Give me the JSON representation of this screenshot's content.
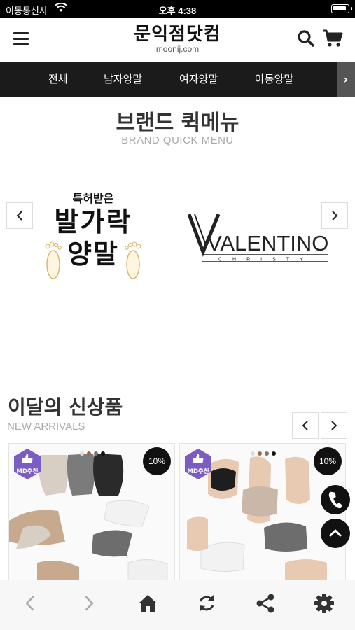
{
  "status_bar": {
    "carrier": "이동통신사",
    "time": "오후 4:38"
  },
  "header": {
    "logo_main": "문익점닷컴",
    "logo_sub": "moonij.com"
  },
  "category_nav": {
    "items": [
      "전체",
      "남자양말",
      "여자양말",
      "아동양말"
    ],
    "more_icon": "chevron-right-icon"
  },
  "brand_menu": {
    "title": "브랜드 퀵메뉴",
    "subtitle": "BRAND QUICK MENU",
    "brands": [
      {
        "small": "특허받은",
        "line1": "발가락",
        "line2": "양말"
      },
      {
        "name": "VALENTINO",
        "sub": "CHRISTY"
      }
    ]
  },
  "new_arrivals": {
    "title": "이달의 신상품",
    "subtitle": "NEW ARRIVALS",
    "products": [
      {
        "badge": "MD추천",
        "discount": "10%"
      },
      {
        "badge": "MD추천",
        "discount": "10%"
      }
    ]
  },
  "colors": {
    "nav_bg": "#1b1b1b",
    "badge_purple": "#7b5cc4",
    "accent_black": "#111111"
  },
  "toolbar": {
    "icons": [
      "back-icon",
      "forward-icon",
      "home-icon",
      "refresh-icon",
      "share-icon",
      "settings-icon"
    ]
  }
}
